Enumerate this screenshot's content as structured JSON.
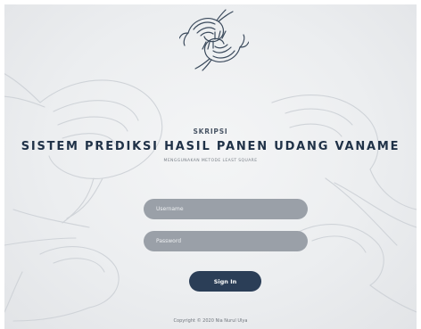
{
  "header": {
    "kicker": "SKRIPSI",
    "title": "SISTEM PREDIKSI HASIL PANEN UDANG VANAME",
    "subtitle": "MENGGUNAKAN METODE LEAST SQUARE"
  },
  "logo": {
    "icon": "shrimp-icon"
  },
  "background": {
    "icon": "shrimp-sketch-illustration"
  },
  "login_form": {
    "username_placeholder": "Username",
    "password_placeholder": "Password",
    "signin_label": "Sign In"
  },
  "footer": {
    "copyright": "Copyright © 2020 Nia Nurul Ulya"
  },
  "colors": {
    "accent": "#2b3e57",
    "input_bg": "#9aa0a8",
    "title": "#1f3147",
    "page_bg": "#eceef0"
  }
}
